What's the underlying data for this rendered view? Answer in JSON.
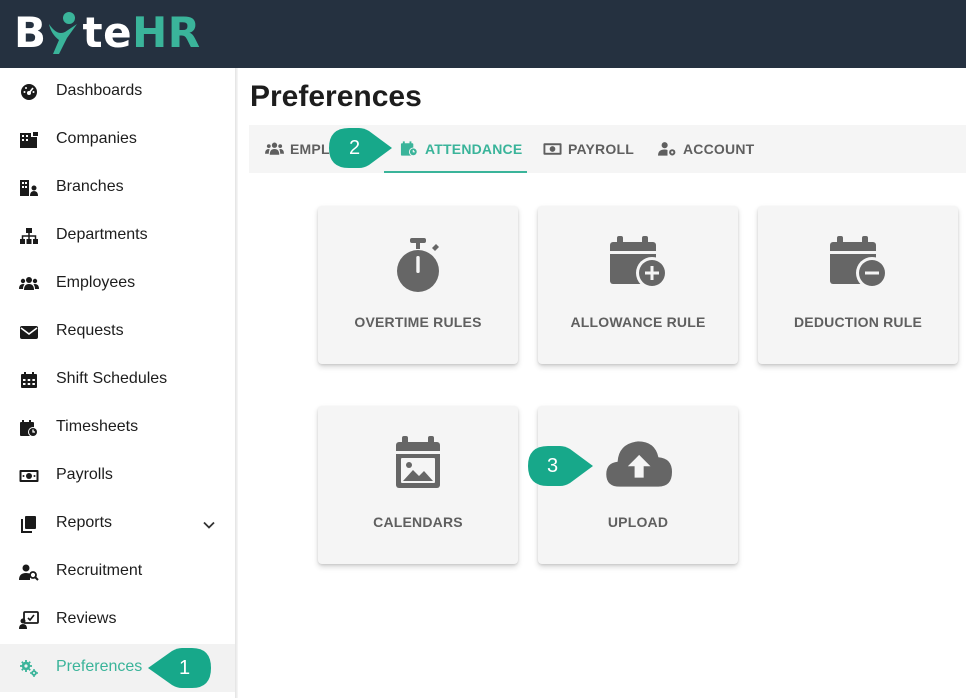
{
  "app": {
    "logo": {
      "part1": "B",
      "part2": "te",
      "part3": "HR"
    },
    "colors": {
      "header_bg": "#253140",
      "accent": "#3ab49a",
      "icon_gray": "#666666"
    }
  },
  "sidebar": {
    "items": [
      {
        "label": "Dashboards",
        "icon": "dashboard-gauge-icon"
      },
      {
        "label": "Companies",
        "icon": "building-icon"
      },
      {
        "label": "Branches",
        "icon": "city-icon"
      },
      {
        "label": "Departments",
        "icon": "sitemap-icon"
      },
      {
        "label": "Employees",
        "icon": "users-icon"
      },
      {
        "label": "Requests",
        "icon": "envelope-icon"
      },
      {
        "label": "Shift Schedules",
        "icon": "calendar-icon"
      },
      {
        "label": "Timesheets",
        "icon": "calendar-clock-icon"
      },
      {
        "label": "Payrolls",
        "icon": "money-bill-icon"
      },
      {
        "label": "Reports",
        "icon": "copy-icon",
        "expandable": true
      },
      {
        "label": "Recruitment",
        "icon": "user-search-icon"
      },
      {
        "label": "Reviews",
        "icon": "review-icon"
      },
      {
        "label": "Preferences",
        "icon": "cogs-icon",
        "active": true
      }
    ]
  },
  "main": {
    "title": "Preferences",
    "tabs": [
      {
        "label": "EMPLO",
        "icon": "users-icon"
      },
      {
        "label": "ATTENDANCE",
        "icon": "calendar-clock-icon",
        "active": true
      },
      {
        "label": "PAYROLL",
        "icon": "money-bill-icon"
      },
      {
        "label": "ACCOUNT",
        "icon": "user-cog-icon"
      }
    ],
    "cards": [
      {
        "label": "OVERTIME RULES",
        "icon": "stopwatch-icon"
      },
      {
        "label": "ALLOWANCE RULE",
        "icon": "calendar-plus-icon"
      },
      {
        "label": "DEDUCTION RULE",
        "icon": "calendar-minus-icon"
      },
      {
        "label": "CALENDARS",
        "icon": "calendar-image-icon"
      },
      {
        "label": "UPLOAD",
        "icon": "cloud-upload-icon"
      }
    ]
  },
  "callouts": [
    "1",
    "2",
    "3"
  ]
}
